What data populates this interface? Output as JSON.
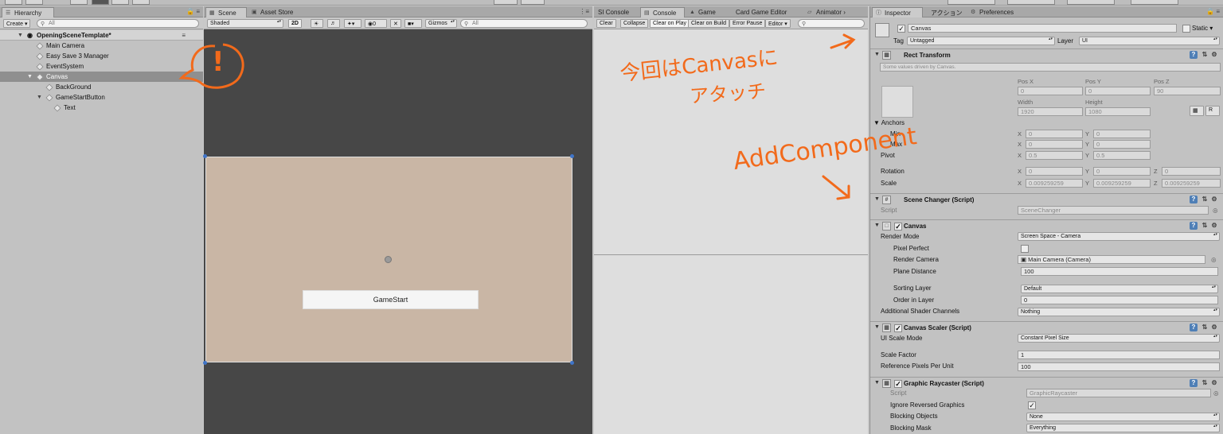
{
  "hierarchy": {
    "tab": "Hierarchy",
    "create": "Create",
    "search_placeholder": "All",
    "scene": "OpeningSceneTemplate*",
    "items": [
      {
        "label": "Main Camera"
      },
      {
        "label": "Easy Save 3 Manager"
      },
      {
        "label": "EventSystem"
      },
      {
        "label": "Canvas"
      },
      {
        "label": "BackGround"
      },
      {
        "label": "GameStartButton"
      },
      {
        "label": "Text"
      }
    ]
  },
  "scene": {
    "tabs": [
      "Scene",
      "Asset Store"
    ],
    "shading": "Shaded",
    "mode2d": "2D",
    "fx_zero": "0",
    "gizmos": "Gizmos",
    "search_placeholder": "All",
    "button_label": "GameStart"
  },
  "console": {
    "tabs": [
      "SI Console",
      "Console",
      "Game",
      "Card Game Editor",
      "Animator"
    ],
    "buttons": [
      "Clear",
      "Collapse",
      "Clear on Play",
      "Clear on Build",
      "Error Pause",
      "Editor"
    ]
  },
  "inspector": {
    "tabs": [
      "Inspector",
      "アクション",
      "Preferences"
    ],
    "object_name": "Canvas",
    "static_label": "Static",
    "tag_label": "Tag",
    "tag_value": "Untagged",
    "layer_label": "Layer",
    "layer_value": "UI",
    "rect": {
      "title": "Rect Transform",
      "note": "Some values driven by Canvas.",
      "posx_label": "Pos X",
      "posy_label": "Pos Y",
      "posz_label": "Pos Z",
      "posx": "0",
      "posy": "0",
      "posz": "90",
      "width_label": "Width",
      "height_label": "Height",
      "width": "1920",
      "height": "1080",
      "r_button": "R",
      "anchors_label": "Anchors",
      "min_label": "Min",
      "max_label": "Max",
      "min_x": "0",
      "min_y": "0",
      "max_x": "0",
      "max_y": "0",
      "pivot_label": "Pivot",
      "pivot_x": "0.5",
      "pivot_y": "0.5",
      "rotation_label": "Rotation",
      "rot_x": "0",
      "rot_y": "0",
      "rot_z": "0",
      "scale_label": "Scale",
      "scale_x": "0.009259259",
      "scale_y": "0.009259259",
      "scale_z": "0.009259259",
      "axis_x": "X",
      "axis_y": "Y",
      "axis_z": "Z"
    },
    "scene_changer": {
      "title": "Scene Changer (Script)",
      "script_label": "Script",
      "script_value": "SceneChanger"
    },
    "canvas": {
      "title": "Canvas",
      "render_mode_label": "Render Mode",
      "render_mode": "Screen Space - Camera",
      "pixel_perfect_label": "Pixel Perfect",
      "render_camera_label": "Render Camera",
      "render_camera": "Main Camera (Camera)",
      "plane_distance_label": "Plane Distance",
      "plane_distance": "100",
      "sorting_layer_label": "Sorting Layer",
      "sorting_layer": "Default",
      "order_label": "Order in Layer",
      "order": "0",
      "shader_channels_label": "Additional Shader Channels",
      "shader_channels": "Nothing"
    },
    "scaler": {
      "title": "Canvas Scaler (Script)",
      "ui_scale_label": "UI Scale Mode",
      "ui_scale": "Constant Pixel Size",
      "scale_factor_label": "Scale Factor",
      "scale_factor": "1",
      "ref_ppu_label": "Reference Pixels Per Unit",
      "ref_ppu": "100"
    },
    "raycaster": {
      "title": "Graphic Raycaster (Script)",
      "script_label": "Script",
      "script_value": "GraphicRaycaster",
      "ignore_label": "Ignore Reversed Graphics",
      "blocking_objects_label": "Blocking Objects",
      "blocking_objects": "None",
      "blocking_mask_label": "Blocking Mask",
      "blocking_mask": "Everything"
    }
  },
  "annotations": {
    "exclaim": "!",
    "note1_line1": "今回はCanvasに",
    "note1_line2": "アタッチ",
    "note2": "AddComponent"
  }
}
